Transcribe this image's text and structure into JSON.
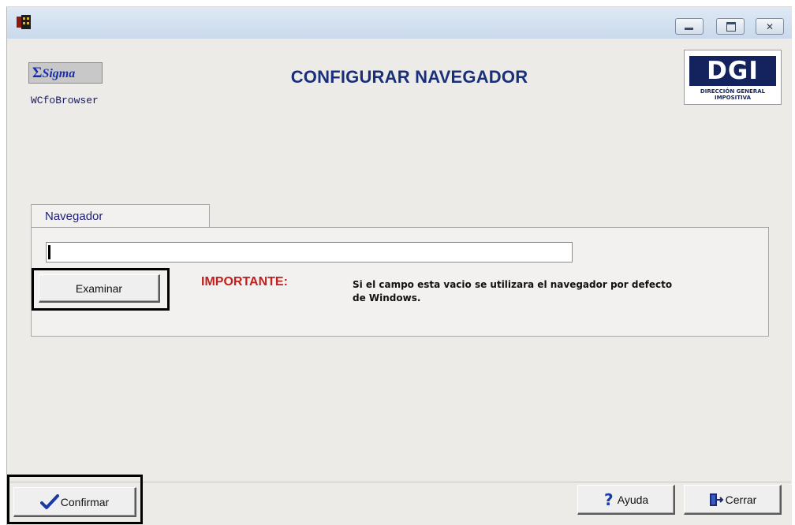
{
  "window": {
    "app_icon": "app-window-icon",
    "controls": [
      "minimize-icon",
      "maximize-icon",
      "close-icon"
    ]
  },
  "header": {
    "brand": "Sigma",
    "brand_symbol": "Σ",
    "module": "WCfoBrowser",
    "title": "CONFIGURAR NAVEGADOR",
    "org_logo": {
      "mark": "DGI",
      "subtitle": "DIRECCIÓN GENERAL IMPOSITIVA"
    }
  },
  "browser_group": {
    "tab_label": "Navegador",
    "path_value": "",
    "browse_button": "Examinar",
    "important_label": "IMPORTANTE:",
    "important_message": "Si el campo esta vacio se utilizara el navegador por defecto de Windows."
  },
  "footer": {
    "confirm_button": "Confirmar",
    "confirm_icon": "checkmark-icon",
    "help_button": "Ayuda",
    "help_icon": "question-mark-icon",
    "close_button": "Cerrar",
    "close_icon": "exit-door-icon"
  },
  "colors": {
    "title_text": "#1a2f7a",
    "important_text": "#c0201f",
    "window_bg": "#ecebe8",
    "logo_navy": "#14235e"
  }
}
